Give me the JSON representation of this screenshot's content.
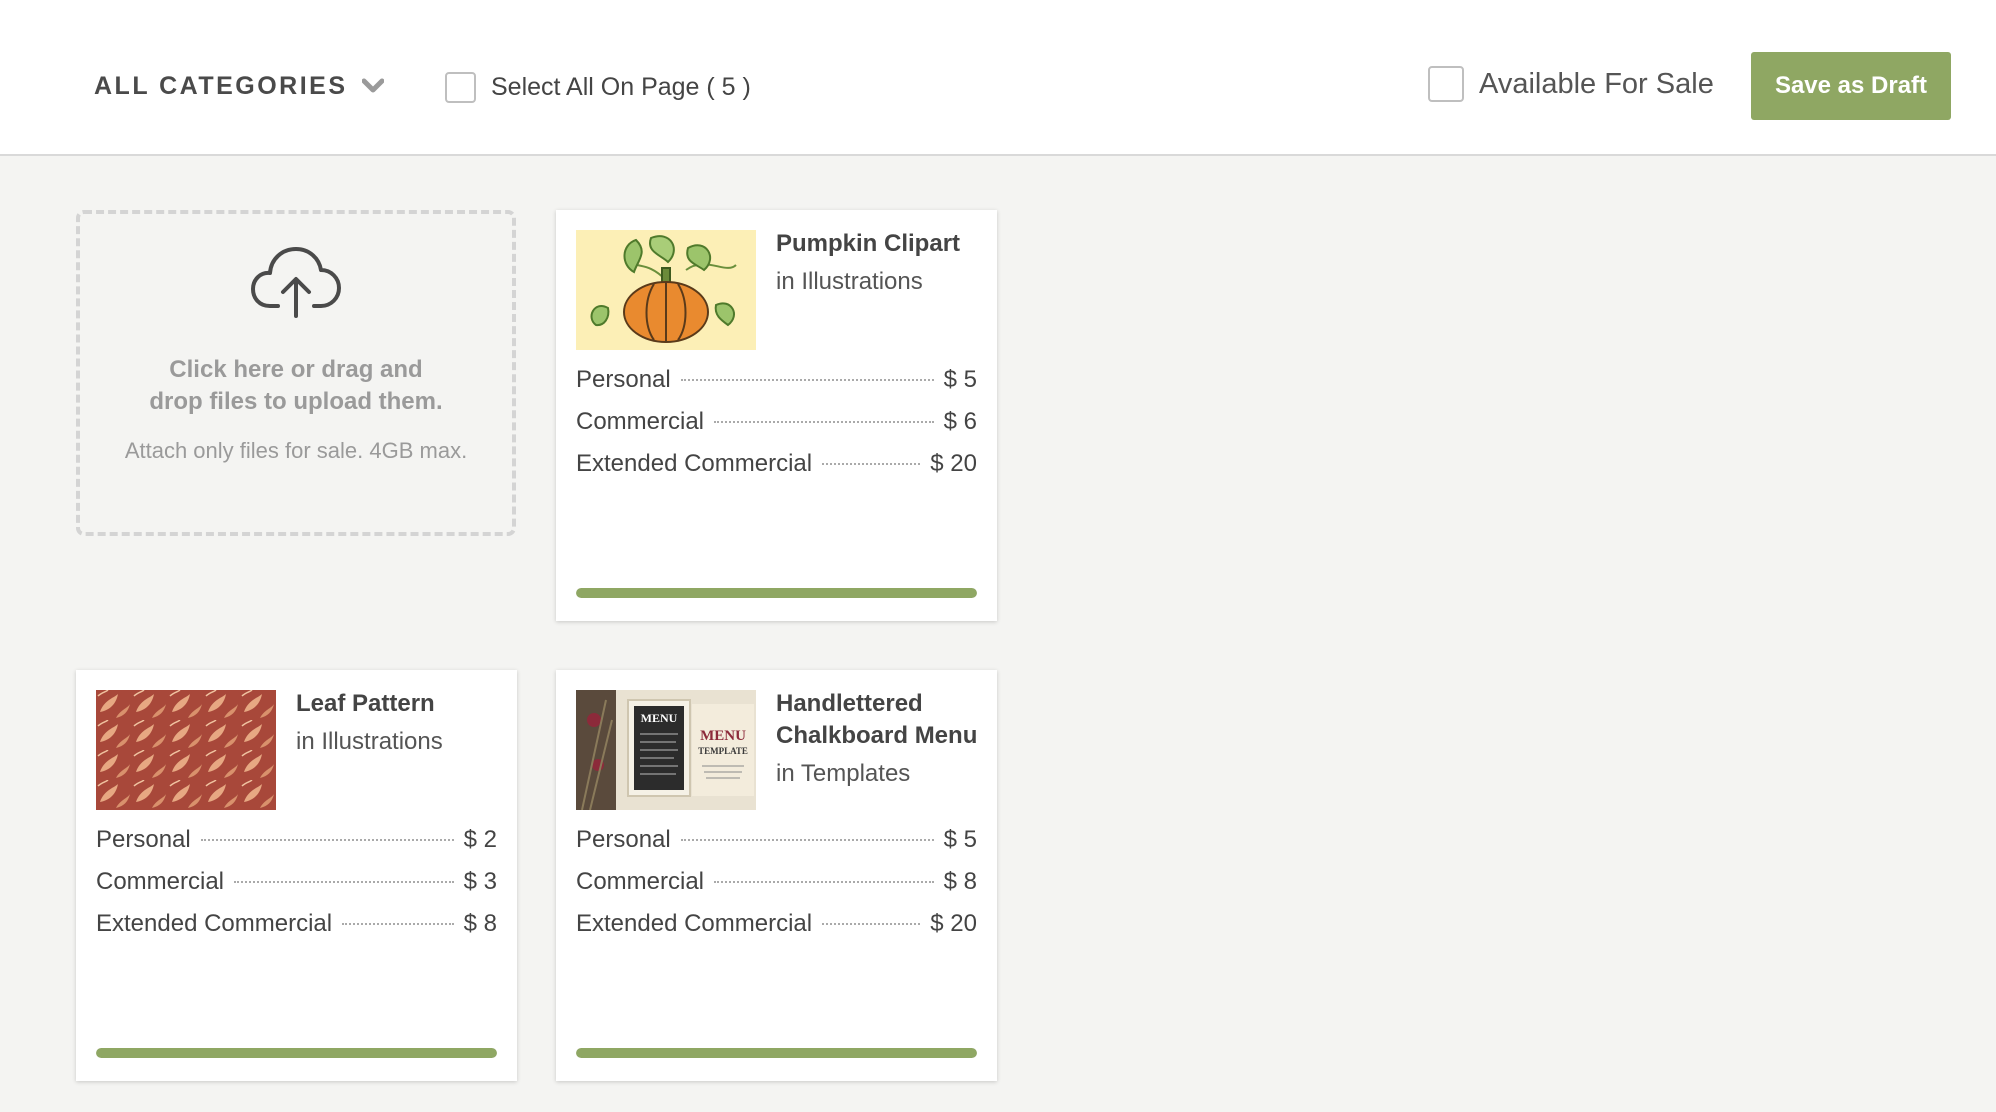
{
  "toolbar": {
    "category_label": "ALL CATEGORIES",
    "select_all_label": "Select All On Page ( 5 )",
    "available_label": "Available For Sale",
    "save_label": "Save as Draft",
    "accent_color": "#8fa763"
  },
  "upload": {
    "icon": "cloud-upload-icon",
    "main_text_line1": "Click here or drag and",
    "main_text_line2": "drop files to upload them.",
    "sub_text": "Attach only files for sale. 4GB max."
  },
  "products": [
    {
      "title": "Pumpkin Clipart",
      "category": "in Illustrations",
      "prices": [
        {
          "label": "Personal",
          "value": "$ 5"
        },
        {
          "label": "Commercial",
          "value": "$ 6"
        },
        {
          "label": "Extended Commercial",
          "value": "$ 20"
        }
      ],
      "progress": 1.0
    },
    {
      "title": "Leaf Pattern",
      "category": "in Illustrations",
      "prices": [
        {
          "label": "Personal",
          "value": "$ 2"
        },
        {
          "label": "Commercial",
          "value": "$ 3"
        },
        {
          "label": "Extended Commercial",
          "value": "$ 8"
        }
      ],
      "progress": 1.0
    },
    {
      "title": "Handlettered Chalkboard Menu",
      "category": "in Templates",
      "thumb_text_1": "MENU",
      "thumb_text_2": "MENU",
      "thumb_text_3": "TEMPLATE",
      "prices": [
        {
          "label": "Personal",
          "value": "$ 5"
        },
        {
          "label": "Commercial",
          "value": "$ 8"
        },
        {
          "label": "Extended Commercial",
          "value": "$ 20"
        }
      ],
      "progress": 1.0
    }
  ]
}
